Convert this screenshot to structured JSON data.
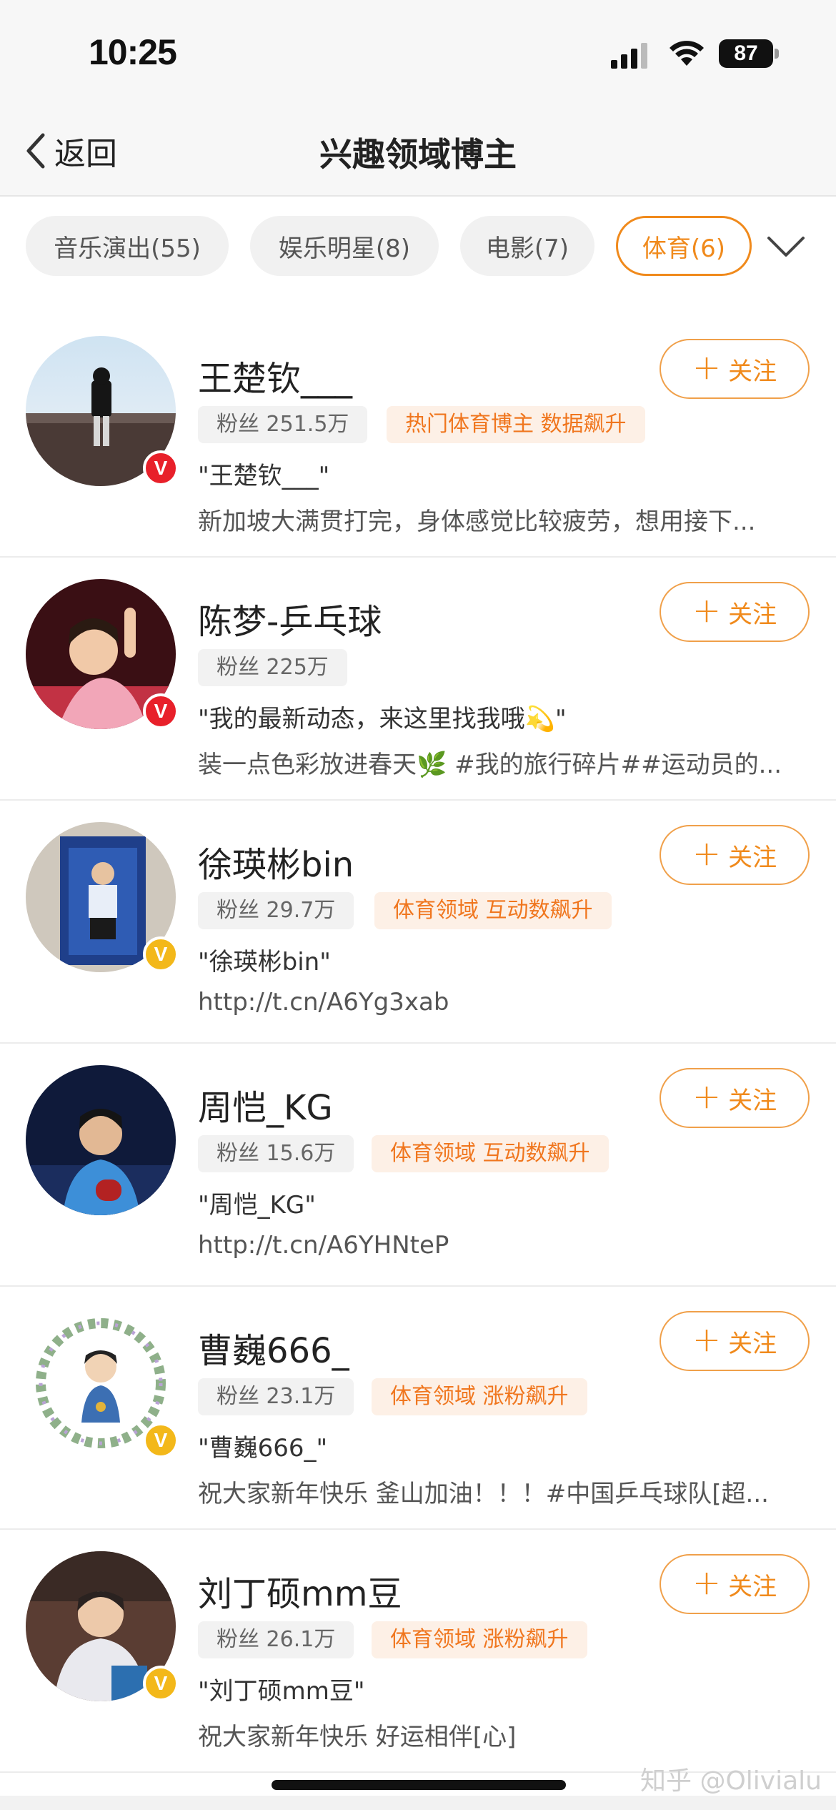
{
  "status_bar": {
    "time": "10:25",
    "battery": "87"
  },
  "nav": {
    "back_label": "返回",
    "title": "兴趣领域博主"
  },
  "chips": [
    {
      "label": "音乐演出(55)",
      "active": false
    },
    {
      "label": "娱乐明星(8)",
      "active": false
    },
    {
      "label": "电影(7)",
      "active": false
    },
    {
      "label": "体育(6)",
      "active": true
    }
  ],
  "follow_label": "关注",
  "bloggers": [
    {
      "name": "王楚钦___",
      "fans": "粉丝 251.5万",
      "tag": "热门体育博主 数据飙升",
      "quote": "\"王楚钦___\"",
      "desc": "新加坡大满贯打完，身体感觉比较疲劳，想用接下...",
      "badge": "red"
    },
    {
      "name": "陈梦-乒乓球",
      "fans": "粉丝 225万",
      "tag": "",
      "quote": "\"我的最新动态，来这里找我哦💫\"",
      "desc": "装一点色彩放进春天🌿 #我的旅行碎片##运动员的...",
      "badge": "red"
    },
    {
      "name": "徐瑛彬bin",
      "fans": "粉丝 29.7万",
      "tag": "体育领域 互动数飙升",
      "quote": "\"徐瑛彬bin\"",
      "desc": "http://t.cn/A6Yg3xab",
      "badge": "gold"
    },
    {
      "name": "周恺_KG",
      "fans": "粉丝 15.6万",
      "tag": "体育领域 互动数飙升",
      "quote": "\"周恺_KG\"",
      "desc": "http://t.cn/A6YHNteP",
      "badge": "none"
    },
    {
      "name": "曹巍666_",
      "fans": "粉丝 23.1万",
      "tag": "体育领域 涨粉飙升",
      "quote": "\"曹巍666_\"",
      "desc": "祝大家新年快乐 釜山加油！！！#中国乒乓球队[超...",
      "badge": "gold"
    },
    {
      "name": "刘丁硕mm豆",
      "fans": "粉丝 26.1万",
      "tag": "体育领域 涨粉飙升",
      "quote": "\"刘丁硕mm豆\"",
      "desc": "祝大家新年快乐 好运相伴[心]",
      "badge": "gold"
    }
  ],
  "watermark": "知乎 @Olivialu",
  "colors": {
    "accent": "#f08a1c",
    "tag_bg": "#fdf0e6",
    "verify_red": "#e8202a",
    "verify_gold": "#f3b81a"
  }
}
